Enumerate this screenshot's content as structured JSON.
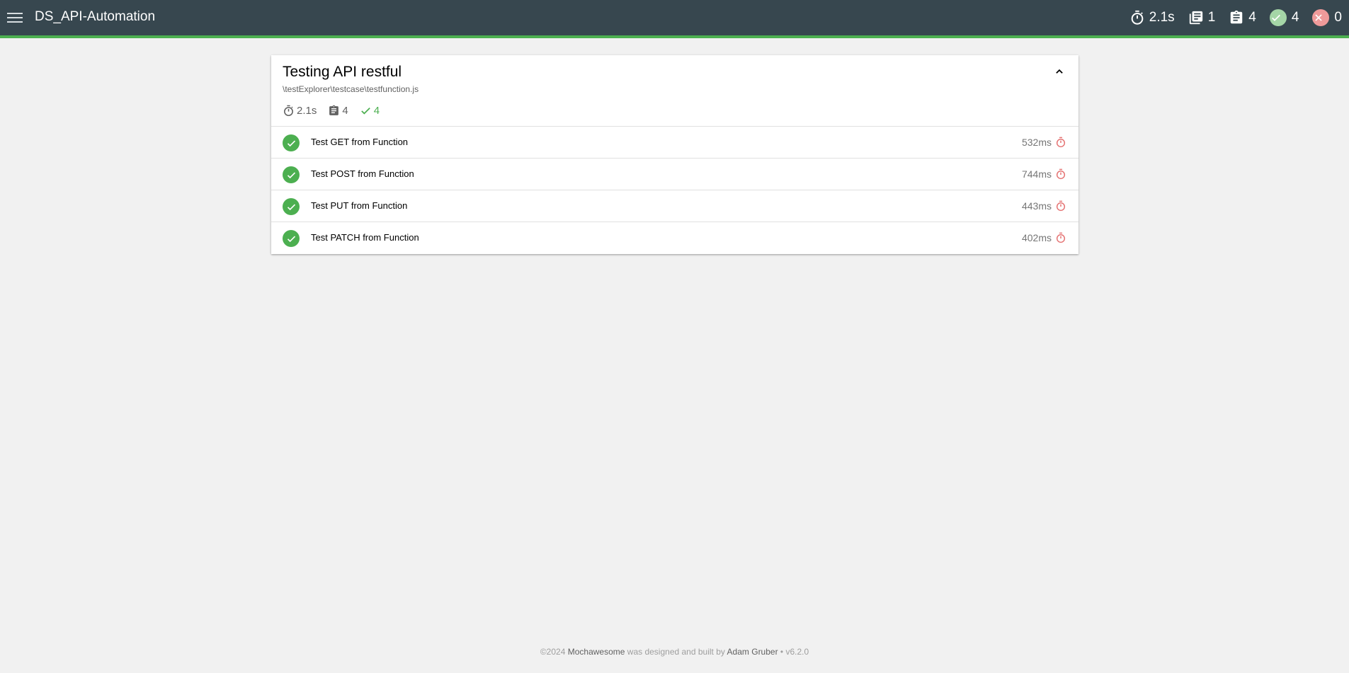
{
  "navbar": {
    "title": "DS_API-Automation",
    "menu_icon": "hamburger-menu-icon",
    "stats": {
      "duration": "2.1s",
      "suites": "1",
      "tests": "4",
      "passes": "4",
      "failures": "0"
    }
  },
  "suite": {
    "title": "Testing API restful",
    "file": "\\testExplorer\\testcase\\testfunction.js",
    "summary": {
      "duration": "2.1s",
      "tests": "4",
      "passes": "4"
    },
    "tests": [
      {
        "title": "Test GET from Function",
        "duration": "532ms",
        "state": "passed"
      },
      {
        "title": "Test POST from Function",
        "duration": "744ms",
        "state": "passed"
      },
      {
        "title": "Test PUT from Function",
        "duration": "443ms",
        "state": "passed"
      },
      {
        "title": "Test PATCH from Function",
        "duration": "402ms",
        "state": "passed"
      }
    ]
  },
  "footer": {
    "copyright": "©2024",
    "product": "Mochawesome",
    "middle": "was designed and built by",
    "author": "Adam Gruber",
    "version": "• v6.2.0"
  },
  "colors": {
    "navbar_bg": "#37474f",
    "accent": "#4caf50",
    "pass_light": "#a5d6a7",
    "fail_light": "#ef9a9a",
    "slow_timer": "#e57373"
  }
}
